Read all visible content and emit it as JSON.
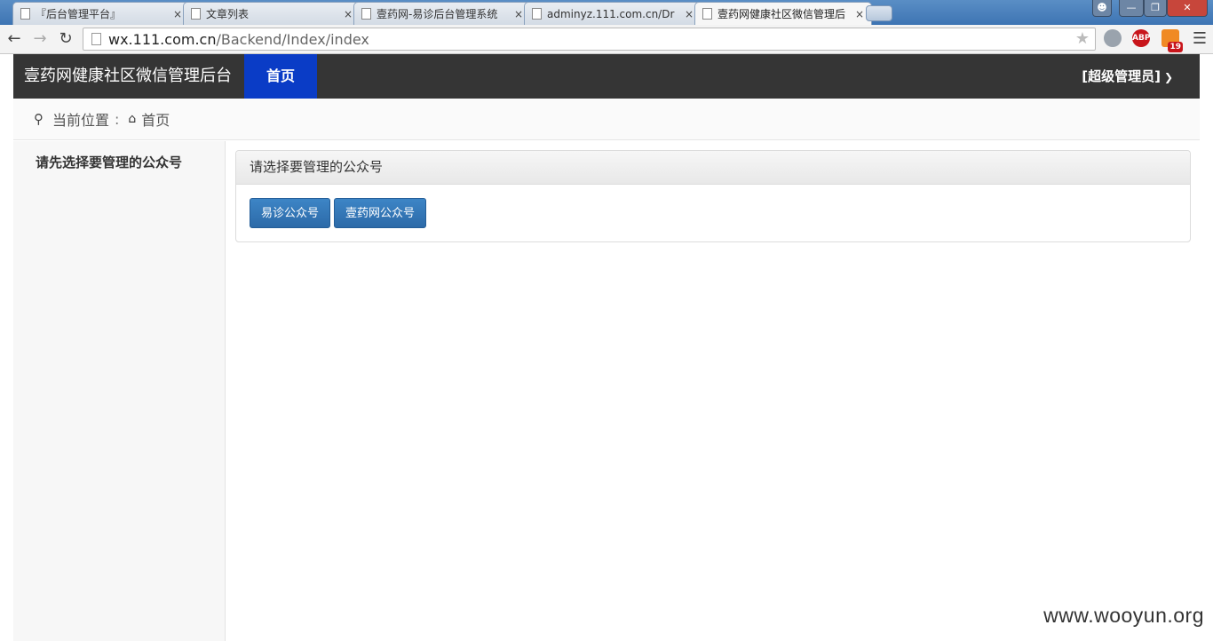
{
  "browser": {
    "tabs": [
      {
        "title": "『后台管理平台』",
        "active": false
      },
      {
        "title": "文章列表",
        "active": false
      },
      {
        "title": "壹药网-易诊后台管理系统",
        "active": false
      },
      {
        "title": "adminyz.111.com.cn/Dr",
        "active": false
      },
      {
        "title": "壹药网健康社区微信管理后",
        "active": true
      }
    ],
    "close_glyph": "×",
    "url_host": "wx.111.com.cn",
    "url_path": "/Backend/Index/index",
    "extensions": {
      "abp_label": "ABP",
      "rss_count": "19"
    }
  },
  "app": {
    "brand": "壹药网健康社区微信管理后台",
    "nav_home": "首页",
    "user_menu": "[超级管理员]"
  },
  "breadcrumb": {
    "label": "当前位置",
    "separator": ":",
    "current": "首页"
  },
  "sidebar": {
    "message": "请先选择要管理的公众号"
  },
  "panel": {
    "title": "请选择要管理的公众号",
    "buttons": [
      "易诊公众号",
      "壹药网公众号"
    ]
  },
  "watermark": "www.wooyun.org",
  "colors": {
    "header_bg": "#353535",
    "nav_active": "#0a3cc6",
    "button": "#3478b8"
  }
}
